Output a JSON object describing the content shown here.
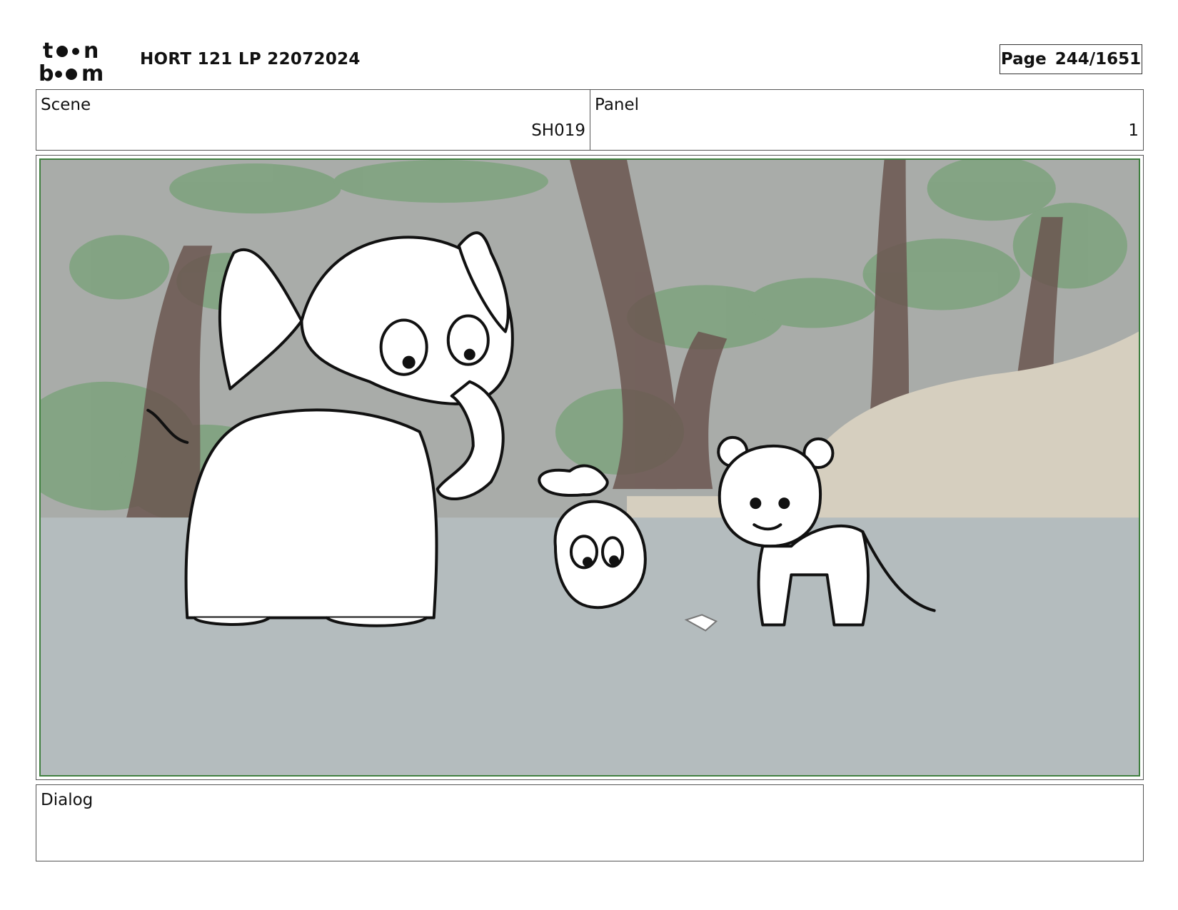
{
  "header": {
    "logo_text": "toon boom",
    "title": "HORT 121 LP 22072024",
    "page_label": "Page",
    "page_value": "244/1651"
  },
  "info": {
    "scene_label": "Scene",
    "scene_value": "SH019",
    "panel_label": "Panel",
    "panel_value": "1"
  },
  "dialog": {
    "label": "Dialog",
    "text": ""
  },
  "colors": {
    "frame_border": "#3f7f3f",
    "background_sky": "#a9aca9",
    "ground": "#b4bcbe",
    "foliage": "#7fa37f",
    "trunk": "#6b5650",
    "rock": "#d6cfbf"
  }
}
